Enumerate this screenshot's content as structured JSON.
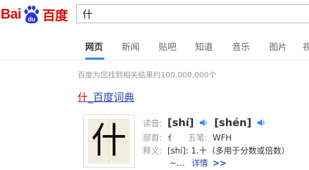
{
  "brand": {
    "logo_text_left": "Bai",
    "logo_text_du": "du",
    "logo_text_right": "百度",
    "color": "#e10601",
    "paw_color": "#2932e1"
  },
  "search": {
    "query": "什"
  },
  "nav": {
    "tabs": [
      "网页",
      "新闻",
      "贴吧",
      "知道",
      "音乐",
      "图片",
      "视"
    ],
    "active_index": 0,
    "accent": "#3388ff"
  },
  "results": {
    "count_text": "百度为您找到相关结果约100,000,000个"
  },
  "dictionary_card": {
    "title_highlight": "什",
    "title_rest": "_百度词典",
    "character": "什",
    "reading_label": "读音:",
    "pinyin_1": "[shí]",
    "pinyin_2": "[shén]",
    "radical_label": "部首:",
    "radical": "亻",
    "wubi_label": "五笔:",
    "wubi": "WFH",
    "meaning_label": "释义:",
    "meaning": "[shí]: 1.十（多用于分数或倍数）",
    "meaning_cont": "~…",
    "more_label": "详情",
    "more_arrow": ">>",
    "link_color": "#2440b3"
  }
}
